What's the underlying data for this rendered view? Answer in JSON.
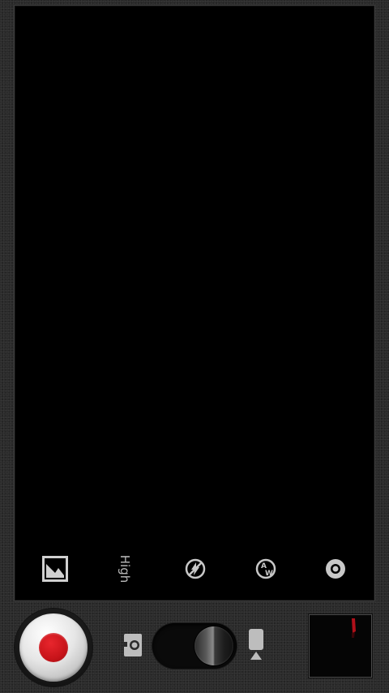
{
  "app": {
    "name": ""
  },
  "settings_bar": {
    "items": [
      {
        "id": "gallery",
        "icon": "gallery-icon"
      },
      {
        "id": "video-quality",
        "label": "High"
      },
      {
        "id": "flash",
        "icon": "flash-off-icon"
      },
      {
        "id": "white-balance",
        "icon": "white-balance-auto-icon"
      },
      {
        "id": "settings",
        "icon": "settings-icon"
      }
    ]
  },
  "controls": {
    "shutter": {
      "icon": "record-icon",
      "color": "#c8141a"
    },
    "mode_switch": {
      "selected": "video",
      "left_icon": "camera-icon",
      "right_icon": "video-camera-icon"
    },
    "thumbnail": {
      "icon": "last-capture-thumbnail"
    }
  },
  "colors": {
    "background": "#2b2b2b",
    "viewfinder": "#000000",
    "record": "#c8141a"
  }
}
